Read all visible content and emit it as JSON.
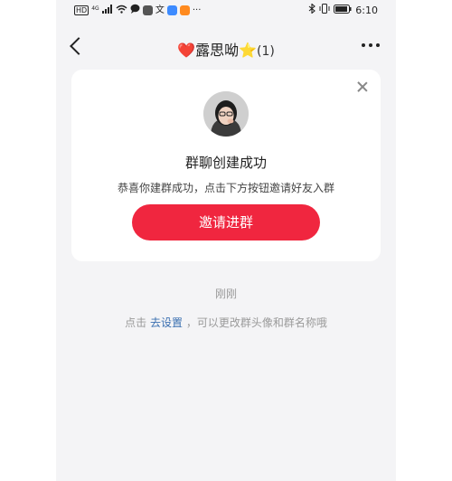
{
  "status_bar": {
    "left_icons": [
      "hd-icon",
      "4g-signal-icon",
      "wifi-icon",
      "chat-icon",
      "app-icon-1",
      "app-icon-2",
      "app-icon-3",
      "app-icon-4",
      "more-notifications-icon"
    ],
    "hd_label": "HD",
    "signal_label": "4G",
    "time": "6:10"
  },
  "nav": {
    "title_heart": "❤️",
    "title_name": "露思呦",
    "title_star": "⭐",
    "title_count": "(1)"
  },
  "card": {
    "title": "群聊创建成功",
    "subtitle": "恭喜你建群成功，点击下方按钮邀请好友入群",
    "invite_label": "邀请进群"
  },
  "chat": {
    "time_label": "刚刚",
    "hint_prefix": "点击",
    "hint_link": "去设置",
    "hint_suffix": "，可以更改群头像和群名称哦"
  },
  "colors": {
    "accent": "#f0263f",
    "link": "#3a6fb0",
    "background": "#f4f4f6"
  }
}
